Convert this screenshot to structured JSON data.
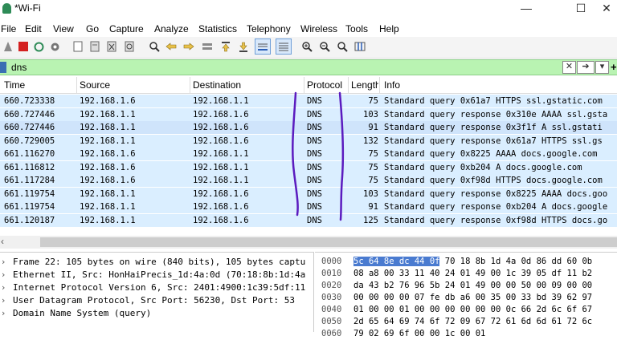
{
  "window": {
    "title": "*Wi-Fi",
    "minimize": "—",
    "maximize": "☐",
    "close": "✕"
  },
  "menu": [
    "File",
    "Edit",
    "View",
    "Go",
    "Capture",
    "Analyze",
    "Statistics",
    "Telephony",
    "Wireless",
    "Tools",
    "Help"
  ],
  "filter": {
    "value": "dns"
  },
  "columns": {
    "time": "Time",
    "source": "Source",
    "destination": "Destination",
    "protocol": "Protocol",
    "length": "Length",
    "info": "Info"
  },
  "packets": [
    {
      "time": "660.723338",
      "src": "192.168.1.6",
      "dst": "192.168.1.1",
      "proto": "DNS",
      "len": "75",
      "info": "Standard query 0x61a7 HTTPS ssl.gstatic.com"
    },
    {
      "time": "660.727446",
      "src": "192.168.1.1",
      "dst": "192.168.1.6",
      "proto": "DNS",
      "len": "103",
      "info": "Standard query response 0x310e AAAA ssl.gsta"
    },
    {
      "time": "660.727446",
      "src": "192.168.1.1",
      "dst": "192.168.1.6",
      "proto": "DNS",
      "len": "91",
      "info": "Standard query response 0x3f1f A ssl.gstati"
    },
    {
      "time": "660.729005",
      "src": "192.168.1.1",
      "dst": "192.168.1.6",
      "proto": "DNS",
      "len": "132",
      "info": "Standard query response 0x61a7 HTTPS ssl.gs"
    },
    {
      "time": "661.116270",
      "src": "192.168.1.6",
      "dst": "192.168.1.1",
      "proto": "DNS",
      "len": "75",
      "info": "Standard query 0x8225 AAAA docs.google.com"
    },
    {
      "time": "661.116812",
      "src": "192.168.1.6",
      "dst": "192.168.1.1",
      "proto": "DNS",
      "len": "75",
      "info": "Standard query 0xb204 A docs.google.com"
    },
    {
      "time": "661.117284",
      "src": "192.168.1.6",
      "dst": "192.168.1.1",
      "proto": "DNS",
      "len": "75",
      "info": "Standard query 0xf98d HTTPS docs.google.com"
    },
    {
      "time": "661.119754",
      "src": "192.168.1.1",
      "dst": "192.168.1.6",
      "proto": "DNS",
      "len": "103",
      "info": "Standard query response 0x8225 AAAA docs.goo"
    },
    {
      "time": "661.119754",
      "src": "192.168.1.1",
      "dst": "192.168.1.6",
      "proto": "DNS",
      "len": "91",
      "info": "Standard query response 0xb204 A docs.google"
    },
    {
      "time": "661.120187",
      "src": "192.168.1.1",
      "dst": "192.168.1.6",
      "proto": "DNS",
      "len": "125",
      "info": "Standard query response 0xf98d HTTPS docs.go"
    }
  ],
  "details": [
    "Frame 22: 105 bytes on wire (840 bits), 105 bytes captu",
    "Ethernet II, Src: HonHaiPrecis_1d:4a:0d (70:18:8b:1d:4a",
    "Internet Protocol Version 6, Src: 2401:4900:1c39:5df:11",
    "User Datagram Protocol, Src Port: 56230, Dst Port: 53",
    "Domain Name System (query)"
  ],
  "bytes": [
    {
      "off": "0000",
      "hl": "5c 64 8e dc 44 0f",
      "rest": " 70 18  8b 1d 4a 0d 86 dd 60 0b"
    },
    {
      "off": "0010",
      "hl": "",
      "rest": "08 a8 00 33 11 40 24 01  49 00 1c 39 05 df 11 b2"
    },
    {
      "off": "0020",
      "hl": "",
      "rest": "da 43 b2 76 96 5b 24 01  49 00 00 50 00 09 00 00"
    },
    {
      "off": "0030",
      "hl": "",
      "rest": "00 00 00 00 07 fe db a6  00 35 00 33 bd 39 62 97"
    },
    {
      "off": "0040",
      "hl": "",
      "rest": "01 00 00 01 00 00 00 00  00 00 0c 66 2d 6c 6f 67"
    },
    {
      "off": "0050",
      "hl": "",
      "rest": "2d 65 64 69 74 6f 72 09  67 72 61 6d 6d 61 72 6c"
    },
    {
      "off": "0060",
      "hl": "",
      "rest": "79 02 69 6f 00 00 1c 00  01"
    }
  ],
  "colors": {
    "row_bg": "#daeeff",
    "selected_row_bg": "#cfe4fb",
    "filter_bg": "#b9f3b2",
    "byte_highlight": "#4a7bd0",
    "annotation": "#5b1bbf"
  },
  "icons": [
    "shark-fin-start-icon",
    "stop-icon",
    "restart-icon",
    "options-gear-icon",
    "open-file-icon",
    "save-file-icon",
    "close-file-icon",
    "reload-icon",
    "find-icon",
    "back-arrow-icon",
    "forward-arrow-icon",
    "go-to-packet-icon",
    "first-packet-icon",
    "last-packet-icon",
    "autoscroll-icon",
    "colorize-icon",
    "zoom-in-icon",
    "zoom-out-icon",
    "normal-size-icon",
    "resize-columns-icon"
  ]
}
